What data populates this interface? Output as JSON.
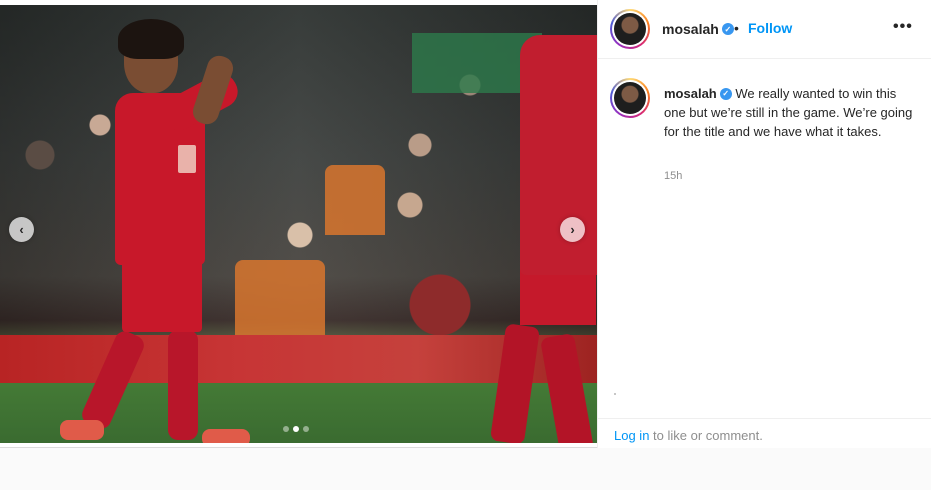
{
  "post": {
    "username": "mosalah",
    "follow_label": "Follow",
    "separator": "•",
    "more_label": "•••",
    "caption": "We really wanted to win this one but we’re still in the game. We’re going for the title and we have what it takes.",
    "time": "15h"
  },
  "carousel": {
    "prev_label": "‹",
    "next_label": "›",
    "slides": 3,
    "active_slide": 2
  },
  "footer": {
    "login_link": "Log in",
    "login_rest": " to like or comment."
  },
  "colors": {
    "accent": "#0095f6",
    "verified": "#3897f0",
    "text": "#262626",
    "muted": "#8e8e8e"
  },
  "icons": {
    "verified": "verified-check-icon",
    "more": "more-options-icon",
    "prev": "chevron-left-icon",
    "next": "chevron-right-icon"
  }
}
